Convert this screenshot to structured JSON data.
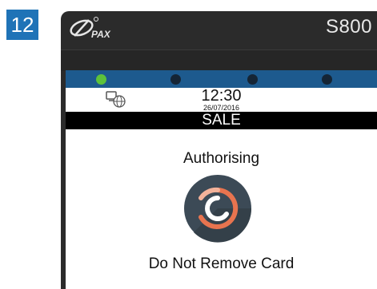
{
  "step": {
    "number": "12"
  },
  "device": {
    "brand": "PAX",
    "model": "S800"
  },
  "leds": [
    {
      "state": "on",
      "color": "#5dc23a"
    },
    {
      "state": "off"
    },
    {
      "state": "off"
    },
    {
      "state": "off"
    }
  ],
  "screen": {
    "status_bar": {
      "time": "12:30",
      "date": "26/07/2016",
      "icon": "network-icon"
    },
    "transaction_type": "SALE",
    "status_message": "Authorising",
    "spinner_icon": "processing-icon",
    "card_message": "Do Not Remove Card"
  },
  "colors": {
    "step_badge": "#1f73b7",
    "led_bar": "#1d5a8e",
    "led_on": "#5dc23a",
    "terminal_body": "#2b2b2b",
    "spinner_bg": "#3c4a56",
    "spinner_accent": "#e8744f"
  }
}
